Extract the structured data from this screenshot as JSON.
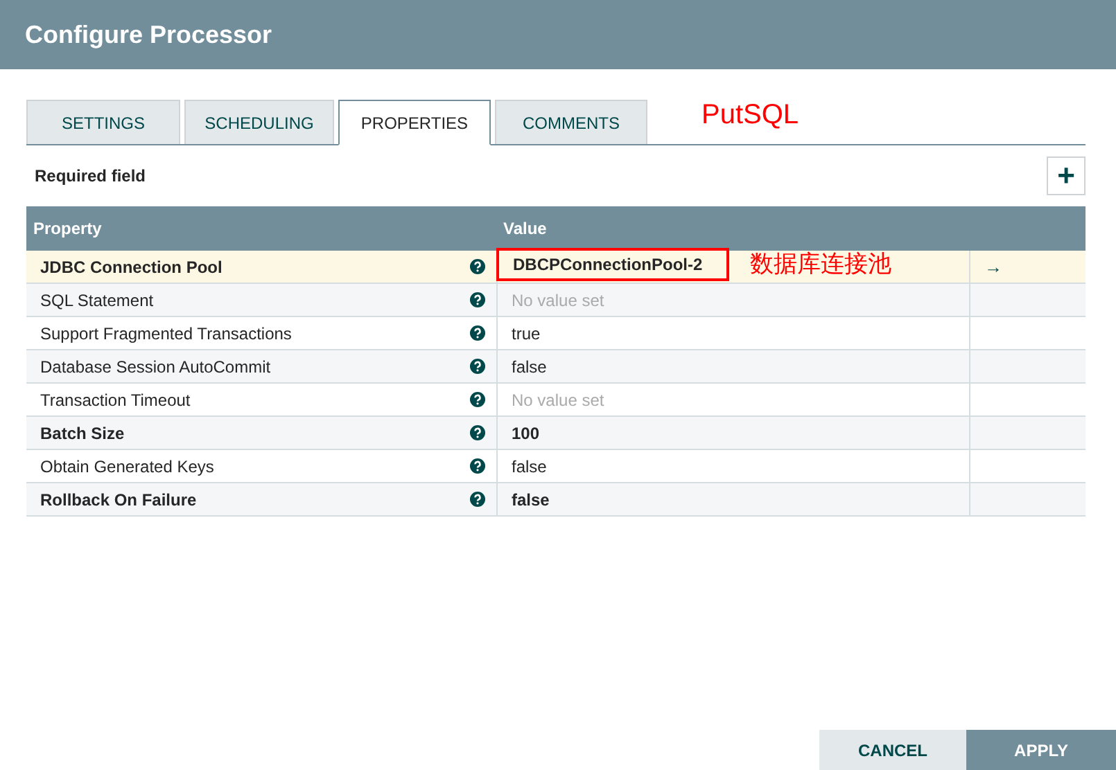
{
  "window": {
    "title": "Configure Processor"
  },
  "tabs": [
    {
      "label": "SETTINGS",
      "selected": false
    },
    {
      "label": "SCHEDULING",
      "selected": false
    },
    {
      "label": "PROPERTIES",
      "selected": true
    },
    {
      "label": "COMMENTS",
      "selected": false
    }
  ],
  "annotations": {
    "processor_name": "PutSQL",
    "pool_note": "数据库连接池"
  },
  "required_label": "Required field",
  "add_button": "+",
  "table": {
    "columns": [
      "Property",
      "Value"
    ],
    "rows": [
      {
        "name": "JDBC Connection Pool",
        "required": true,
        "value": "DBCPConnectionPool-2",
        "placeholder": false,
        "selected": true,
        "highlighted_box": true,
        "action": "→"
      },
      {
        "name": "SQL Statement",
        "required": false,
        "value": "No value set",
        "placeholder": true,
        "selected": false,
        "highlighted_box": false
      },
      {
        "name": "Support Fragmented Transactions",
        "required": false,
        "value": "true",
        "placeholder": false,
        "selected": false,
        "highlighted_box": false
      },
      {
        "name": "Database Session AutoCommit",
        "required": false,
        "value": "false",
        "placeholder": false,
        "selected": false,
        "highlighted_box": false
      },
      {
        "name": "Transaction Timeout",
        "required": false,
        "value": "No value set",
        "placeholder": true,
        "selected": false,
        "highlighted_box": false
      },
      {
        "name": "Batch Size",
        "required": true,
        "value": "100",
        "placeholder": false,
        "selected": false,
        "highlighted_box": false
      },
      {
        "name": "Obtain Generated Keys",
        "required": false,
        "value": "false",
        "placeholder": false,
        "selected": false,
        "highlighted_box": false
      },
      {
        "name": "Rollback On Failure",
        "required": true,
        "value": "false",
        "placeholder": false,
        "selected": false,
        "highlighted_box": false
      }
    ]
  },
  "buttons": [
    {
      "label": "CANCEL",
      "kind": "secondary"
    },
    {
      "label": "APPLY",
      "kind": "primary"
    }
  ]
}
